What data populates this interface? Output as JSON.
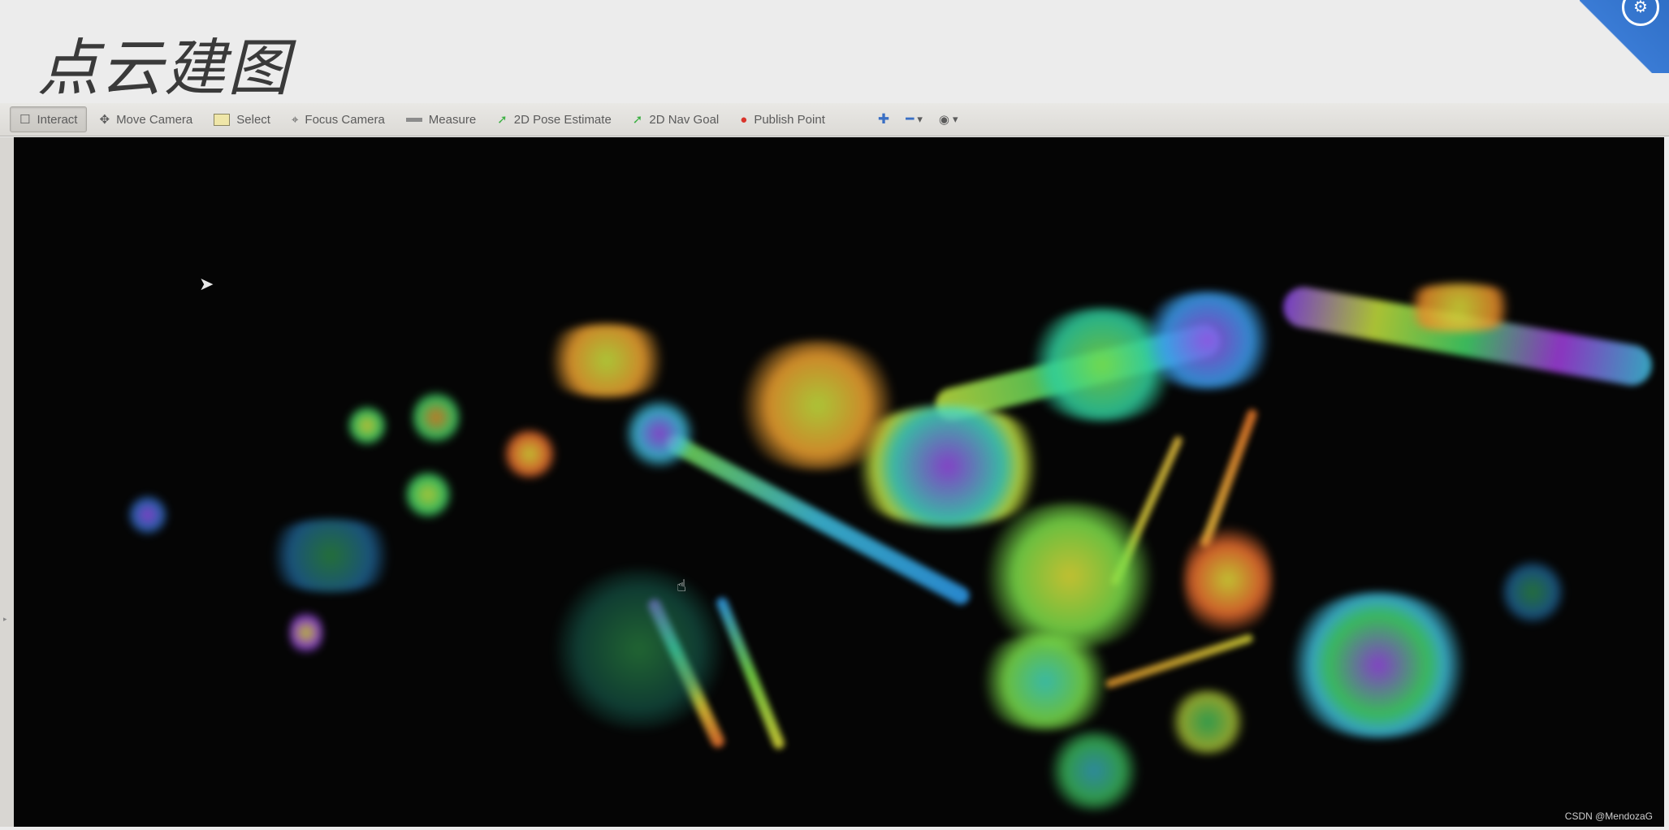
{
  "slide": {
    "title": "点云建图"
  },
  "toolbar": {
    "tools": [
      {
        "label": "Interact",
        "icon": "hand-icon",
        "active": true
      },
      {
        "label": "Move Camera",
        "icon": "move-camera-icon",
        "active": false
      },
      {
        "label": "Select",
        "icon": "select-icon",
        "active": false
      },
      {
        "label": "Focus Camera",
        "icon": "focus-camera-icon",
        "active": false
      },
      {
        "label": "Measure",
        "icon": "ruler-icon",
        "active": false
      },
      {
        "label": "2D Pose Estimate",
        "icon": "pose-arrow-icon",
        "active": false
      },
      {
        "label": "2D Nav Goal",
        "icon": "nav-arrow-icon",
        "active": false
      },
      {
        "label": "Publish Point",
        "icon": "map-pin-icon",
        "active": false
      }
    ]
  },
  "watermark": "CSDN @MendozaG",
  "colors": {
    "accent_blue": "#3a7bd5",
    "viewport_bg": "#050505",
    "pose_green": "#3cb043",
    "pin_red": "#d9342b"
  }
}
